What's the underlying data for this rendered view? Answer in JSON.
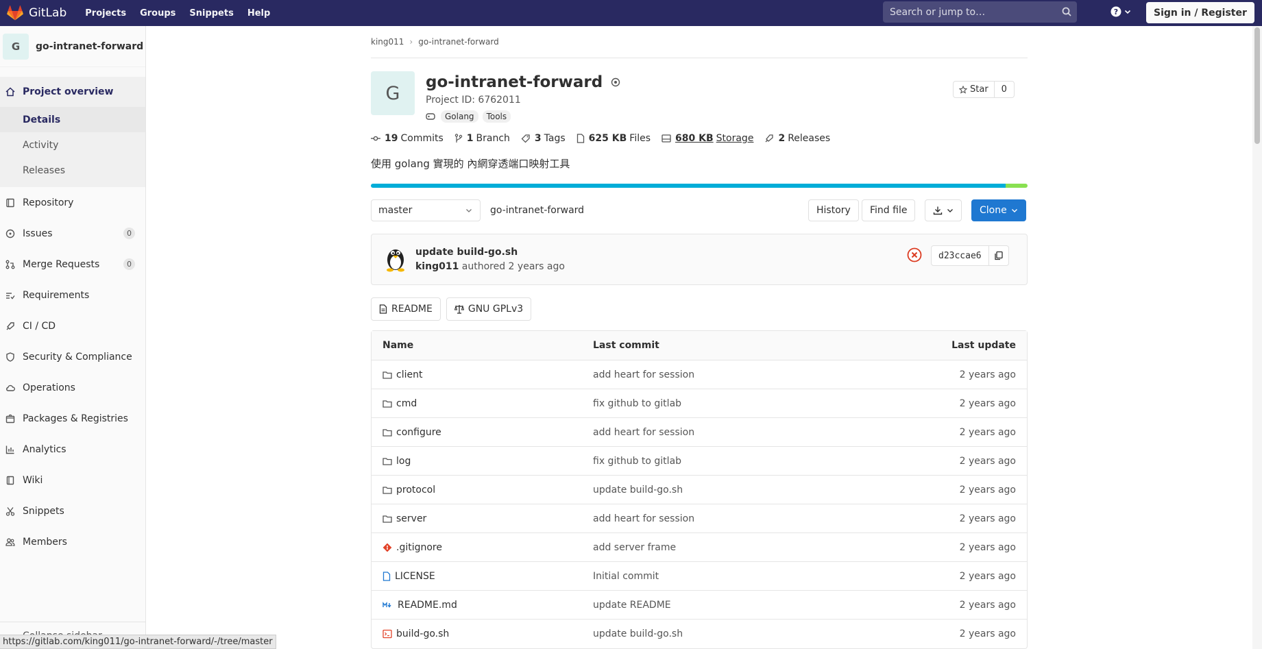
{
  "topbar": {
    "brand": "GitLab",
    "nav": [
      "Projects",
      "Groups",
      "Snippets",
      "Help"
    ],
    "search_placeholder": "Search or jump to…",
    "signin": "Sign in / Register"
  },
  "sidebar": {
    "avatar_letter": "G",
    "project_name": "go-intranet-forward",
    "overview": "Project overview",
    "sub_items": [
      "Details",
      "Activity",
      "Releases"
    ],
    "items": [
      {
        "label": "Repository"
      },
      {
        "label": "Issues",
        "count": "0"
      },
      {
        "label": "Merge Requests",
        "count": "0"
      },
      {
        "label": "Requirements"
      },
      {
        "label": "CI / CD"
      },
      {
        "label": "Security & Compliance"
      },
      {
        "label": "Operations"
      },
      {
        "label": "Packages & Registries"
      },
      {
        "label": "Analytics"
      },
      {
        "label": "Wiki"
      },
      {
        "label": "Snippets"
      },
      {
        "label": "Members"
      }
    ],
    "collapse": "Collapse sidebar"
  },
  "status_url": "https://gitlab.com/king011/go-intranet-forward/-/tree/master",
  "breadcrumb": [
    "king011",
    "go-intranet-forward"
  ],
  "project": {
    "avatar_letter": "G",
    "title": "go-intranet-forward",
    "project_id": "Project ID: 6762011",
    "topics": [
      "Golang",
      "Tools"
    ],
    "star_label": "Star",
    "star_count": "0",
    "description": "使用 golang 實現的 內網穿透端口映射工具"
  },
  "stats": {
    "commits_n": "19",
    "commits_l": "Commits",
    "branch_n": "1",
    "branch_l": "Branch",
    "tags_n": "3",
    "tags_l": "Tags",
    "files_n": "625 KB",
    "files_l": "Files",
    "storage_n": "680 KB",
    "storage_l": "Storage",
    "releases_n": "2",
    "releases_l": "Releases"
  },
  "languages": [
    {
      "color": "#00add8",
      "fraction": 0.967
    },
    {
      "color": "#89e051",
      "fraction": 0.033
    }
  ],
  "toolbar": {
    "branch": "master",
    "path": "go-intranet-forward",
    "history": "History",
    "find_file": "Find file",
    "clone": "Clone"
  },
  "last_commit": {
    "message": "update build-go.sh",
    "author": "king011",
    "authored": "authored 2 years ago",
    "sha": "d23ccae6"
  },
  "doc_buttons": [
    "README",
    "GNU GPLv3"
  ],
  "table": {
    "headers": [
      "Name",
      "Last commit",
      "Last update"
    ],
    "rows": [
      {
        "name": "client",
        "icon": "folder-icon",
        "commit": "add heart for session",
        "date": "2 years ago"
      },
      {
        "name": "cmd",
        "icon": "folder-icon",
        "commit": "fix github to gitlab",
        "date": "2 years ago"
      },
      {
        "name": "configure",
        "icon": "folder-icon",
        "commit": "add heart for session",
        "date": "2 years ago"
      },
      {
        "name": "log",
        "icon": "folder-icon",
        "commit": "fix github to gitlab",
        "date": "2 years ago"
      },
      {
        "name": "protocol",
        "icon": "folder-icon",
        "commit": "update build-go.sh",
        "date": "2 years ago"
      },
      {
        "name": "server",
        "icon": "folder-icon",
        "commit": "add heart for session",
        "date": "2 years ago"
      },
      {
        "name": ".gitignore",
        "icon": "git-icon",
        "commit": "add server frame",
        "date": "2 years ago"
      },
      {
        "name": "LICENSE",
        "icon": "file-icon",
        "commit": "Initial commit",
        "date": "2 years ago"
      },
      {
        "name": "README.md",
        "icon": "markdown-icon",
        "commit": "update README",
        "date": "2 years ago"
      },
      {
        "name": "build-go.sh",
        "icon": "shell-icon",
        "commit": "update build-go.sh",
        "date": "2 years ago"
      }
    ]
  }
}
